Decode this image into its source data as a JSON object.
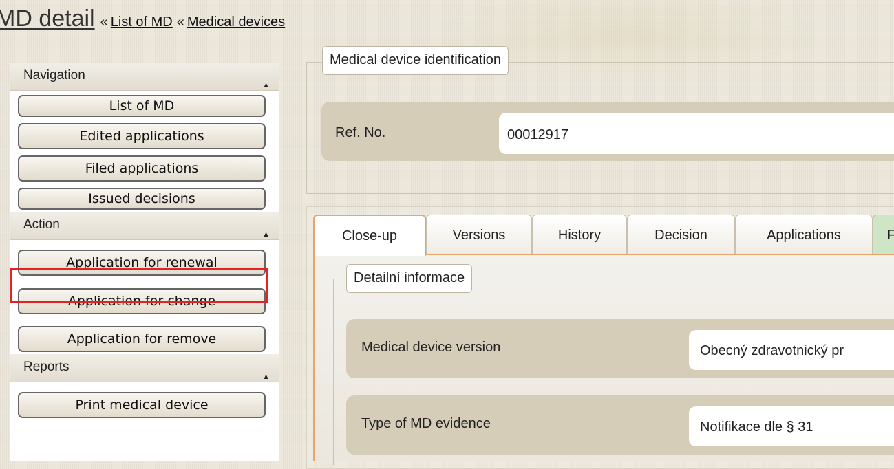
{
  "header": {
    "title": "MD detail",
    "breadcrumb": [
      {
        "sep": "«",
        "label": "List of MD"
      },
      {
        "sep": "«",
        "label": "Medical devices"
      }
    ]
  },
  "sidebar": {
    "sections": [
      {
        "title": "Navigation",
        "items": [
          "List of MD",
          "Edited applications",
          "Filed applications",
          "Issued decisions"
        ]
      },
      {
        "title": "Action",
        "items": [
          "Application for renewal",
          "Application for change",
          "Application for remove"
        ]
      },
      {
        "title": "Reports",
        "items": [
          "Print medical device"
        ]
      }
    ],
    "highlighted_item": "Application for renewal"
  },
  "identification": {
    "legend": "Medical device identification",
    "ref_label": "Ref. No.",
    "ref_value": "00012917"
  },
  "tabs": [
    {
      "label": "Close-up",
      "active": true
    },
    {
      "label": "Versions"
    },
    {
      "label": "History"
    },
    {
      "label": "Decision"
    },
    {
      "label": "Applications"
    },
    {
      "label": "F"
    }
  ],
  "detail": {
    "legend": "Detailní informace",
    "fields": [
      {
        "label": "Medical device version",
        "value": "Obecný zdravotnický pr"
      },
      {
        "label": "Type of MD evidence",
        "value": "Notifikace dle § 31"
      }
    ]
  },
  "colors": {
    "highlight_border": "#e32226",
    "active_tab_border": "#e9a36d",
    "field_row_bg": "#d6cdb8",
    "background": "#ebe6d9"
  }
}
